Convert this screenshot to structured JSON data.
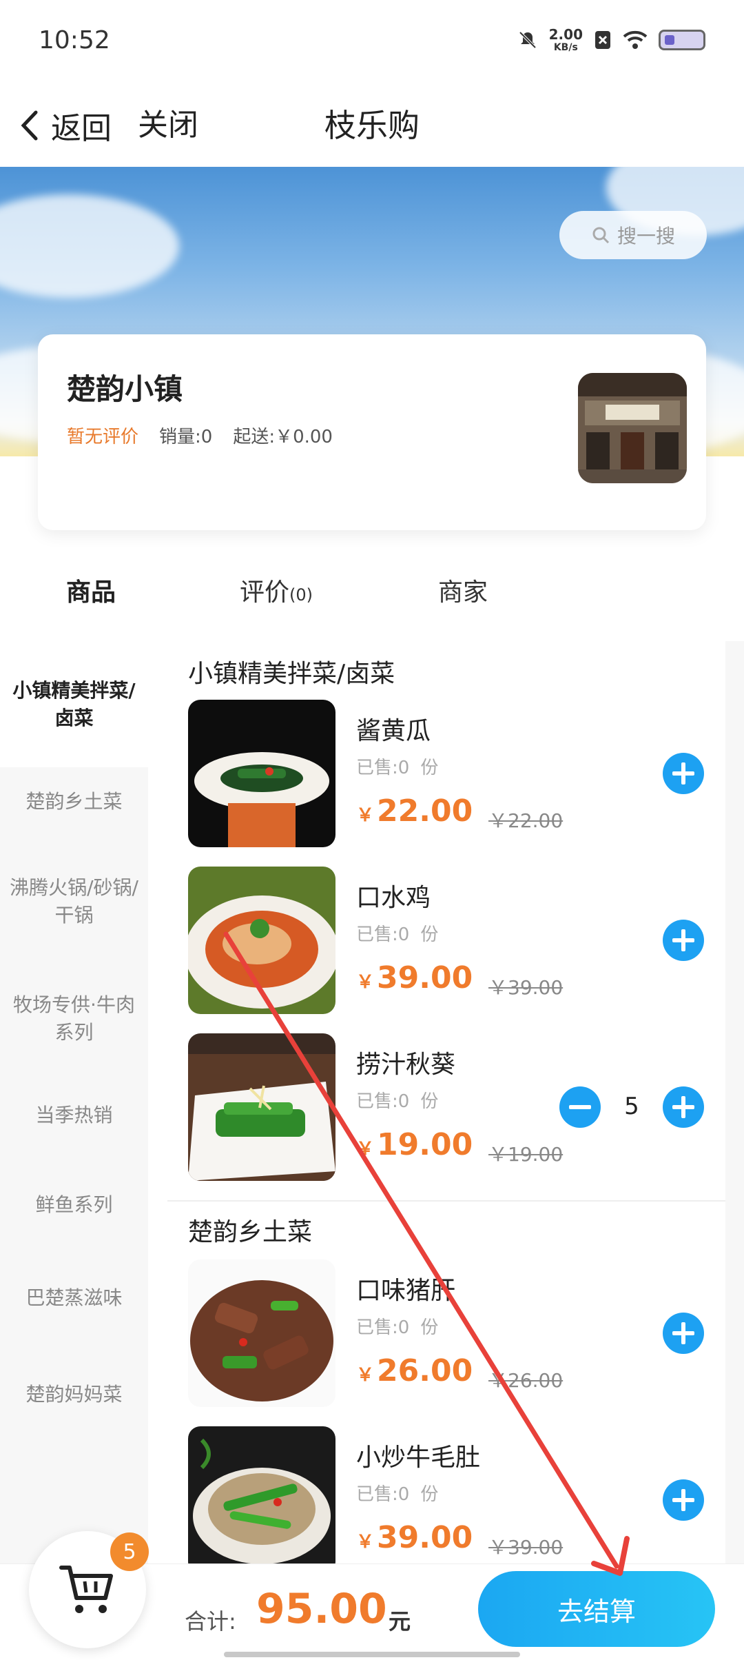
{
  "status_bar": {
    "time": "10:52",
    "net_speed": "2.00",
    "net_unit": "KB/s"
  },
  "nav": {
    "back_label": "返回",
    "close_label": "关闭",
    "title": "枝乐购"
  },
  "search": {
    "placeholder": "搜一搜"
  },
  "store": {
    "name": "楚韵小镇",
    "rating": "暂无评价",
    "sales": "销量:0",
    "min_delivery": "起送:￥0.00"
  },
  "tabs": [
    {
      "label": "商品",
      "count": ""
    },
    {
      "label": "评价",
      "count": "(0)"
    },
    {
      "label": "商家",
      "count": ""
    }
  ],
  "categories": [
    "小镇精美拌菜/卤菜",
    "楚韵乡土菜",
    "沸腾火锅/砂锅/干锅",
    "牧场专供·牛肉系列",
    "当季热销",
    "鲜鱼系列",
    "巴楚蒸滋味",
    "楚韵妈妈菜"
  ],
  "sections": [
    {
      "title": "小镇精美拌菜/卤菜",
      "items": [
        {
          "name": "酱黄瓜",
          "sold": "已售:0",
          "unit": "份",
          "price": "22.00",
          "orig": "￥22.00"
        },
        {
          "name": "口水鸡",
          "sold": "已售:0",
          "unit": "份",
          "price": "39.00",
          "orig": "￥39.00"
        },
        {
          "name": "捞汁秋葵",
          "sold": "已售:0",
          "unit": "份",
          "price": "19.00",
          "orig": "￥19.00",
          "qty": "5"
        }
      ]
    },
    {
      "title": "楚韵乡土菜",
      "items": [
        {
          "name": "口味猪肝",
          "sold": "已售:0",
          "unit": "份",
          "price": "26.00",
          "orig": "￥26.00"
        },
        {
          "name": "小炒牛毛肚",
          "sold": "已售:0",
          "unit": "份",
          "price": "39.00",
          "orig": "￥39.00"
        }
      ]
    }
  ],
  "price_symbol": "￥",
  "cart": {
    "badge": "5",
    "total_label": "合计:",
    "total": "95.00",
    "total_unit": "元",
    "checkout": "去结算"
  },
  "colors": {
    "accent_blue": "#1da1f2",
    "price_orange": "#f07b2c",
    "annotation_red": "#e8413a"
  }
}
